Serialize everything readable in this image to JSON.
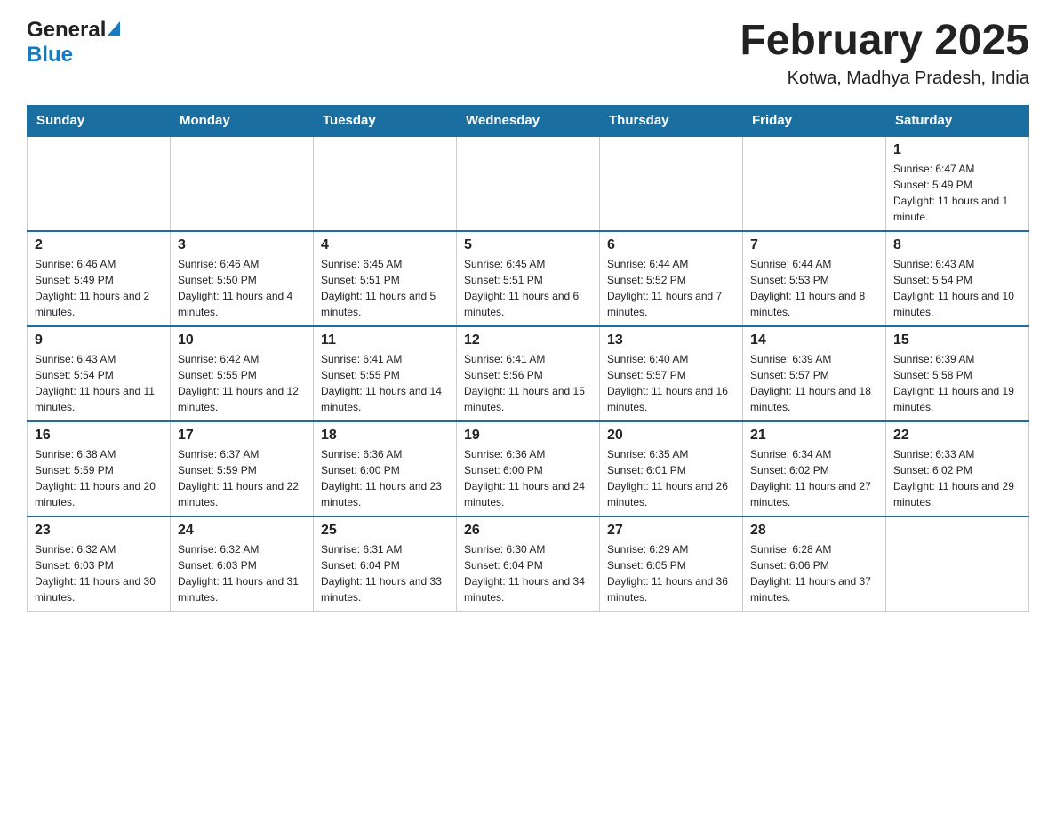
{
  "header": {
    "logo_general": "General",
    "logo_blue": "Blue",
    "month_title": "February 2025",
    "location": "Kotwa, Madhya Pradesh, India"
  },
  "weekdays": [
    "Sunday",
    "Monday",
    "Tuesday",
    "Wednesday",
    "Thursday",
    "Friday",
    "Saturday"
  ],
  "weeks": [
    [
      {
        "day": "",
        "info": ""
      },
      {
        "day": "",
        "info": ""
      },
      {
        "day": "",
        "info": ""
      },
      {
        "day": "",
        "info": ""
      },
      {
        "day": "",
        "info": ""
      },
      {
        "day": "",
        "info": ""
      },
      {
        "day": "1",
        "info": "Sunrise: 6:47 AM\nSunset: 5:49 PM\nDaylight: 11 hours and 1 minute."
      }
    ],
    [
      {
        "day": "2",
        "info": "Sunrise: 6:46 AM\nSunset: 5:49 PM\nDaylight: 11 hours and 2 minutes."
      },
      {
        "day": "3",
        "info": "Sunrise: 6:46 AM\nSunset: 5:50 PM\nDaylight: 11 hours and 4 minutes."
      },
      {
        "day": "4",
        "info": "Sunrise: 6:45 AM\nSunset: 5:51 PM\nDaylight: 11 hours and 5 minutes."
      },
      {
        "day": "5",
        "info": "Sunrise: 6:45 AM\nSunset: 5:51 PM\nDaylight: 11 hours and 6 minutes."
      },
      {
        "day": "6",
        "info": "Sunrise: 6:44 AM\nSunset: 5:52 PM\nDaylight: 11 hours and 7 minutes."
      },
      {
        "day": "7",
        "info": "Sunrise: 6:44 AM\nSunset: 5:53 PM\nDaylight: 11 hours and 8 minutes."
      },
      {
        "day": "8",
        "info": "Sunrise: 6:43 AM\nSunset: 5:54 PM\nDaylight: 11 hours and 10 minutes."
      }
    ],
    [
      {
        "day": "9",
        "info": "Sunrise: 6:43 AM\nSunset: 5:54 PM\nDaylight: 11 hours and 11 minutes."
      },
      {
        "day": "10",
        "info": "Sunrise: 6:42 AM\nSunset: 5:55 PM\nDaylight: 11 hours and 12 minutes."
      },
      {
        "day": "11",
        "info": "Sunrise: 6:41 AM\nSunset: 5:55 PM\nDaylight: 11 hours and 14 minutes."
      },
      {
        "day": "12",
        "info": "Sunrise: 6:41 AM\nSunset: 5:56 PM\nDaylight: 11 hours and 15 minutes."
      },
      {
        "day": "13",
        "info": "Sunrise: 6:40 AM\nSunset: 5:57 PM\nDaylight: 11 hours and 16 minutes."
      },
      {
        "day": "14",
        "info": "Sunrise: 6:39 AM\nSunset: 5:57 PM\nDaylight: 11 hours and 18 minutes."
      },
      {
        "day": "15",
        "info": "Sunrise: 6:39 AM\nSunset: 5:58 PM\nDaylight: 11 hours and 19 minutes."
      }
    ],
    [
      {
        "day": "16",
        "info": "Sunrise: 6:38 AM\nSunset: 5:59 PM\nDaylight: 11 hours and 20 minutes."
      },
      {
        "day": "17",
        "info": "Sunrise: 6:37 AM\nSunset: 5:59 PM\nDaylight: 11 hours and 22 minutes."
      },
      {
        "day": "18",
        "info": "Sunrise: 6:36 AM\nSunset: 6:00 PM\nDaylight: 11 hours and 23 minutes."
      },
      {
        "day": "19",
        "info": "Sunrise: 6:36 AM\nSunset: 6:00 PM\nDaylight: 11 hours and 24 minutes."
      },
      {
        "day": "20",
        "info": "Sunrise: 6:35 AM\nSunset: 6:01 PM\nDaylight: 11 hours and 26 minutes."
      },
      {
        "day": "21",
        "info": "Sunrise: 6:34 AM\nSunset: 6:02 PM\nDaylight: 11 hours and 27 minutes."
      },
      {
        "day": "22",
        "info": "Sunrise: 6:33 AM\nSunset: 6:02 PM\nDaylight: 11 hours and 29 minutes."
      }
    ],
    [
      {
        "day": "23",
        "info": "Sunrise: 6:32 AM\nSunset: 6:03 PM\nDaylight: 11 hours and 30 minutes."
      },
      {
        "day": "24",
        "info": "Sunrise: 6:32 AM\nSunset: 6:03 PM\nDaylight: 11 hours and 31 minutes."
      },
      {
        "day": "25",
        "info": "Sunrise: 6:31 AM\nSunset: 6:04 PM\nDaylight: 11 hours and 33 minutes."
      },
      {
        "day": "26",
        "info": "Sunrise: 6:30 AM\nSunset: 6:04 PM\nDaylight: 11 hours and 34 minutes."
      },
      {
        "day": "27",
        "info": "Sunrise: 6:29 AM\nSunset: 6:05 PM\nDaylight: 11 hours and 36 minutes."
      },
      {
        "day": "28",
        "info": "Sunrise: 6:28 AM\nSunset: 6:06 PM\nDaylight: 11 hours and 37 minutes."
      },
      {
        "day": "",
        "info": ""
      }
    ]
  ]
}
